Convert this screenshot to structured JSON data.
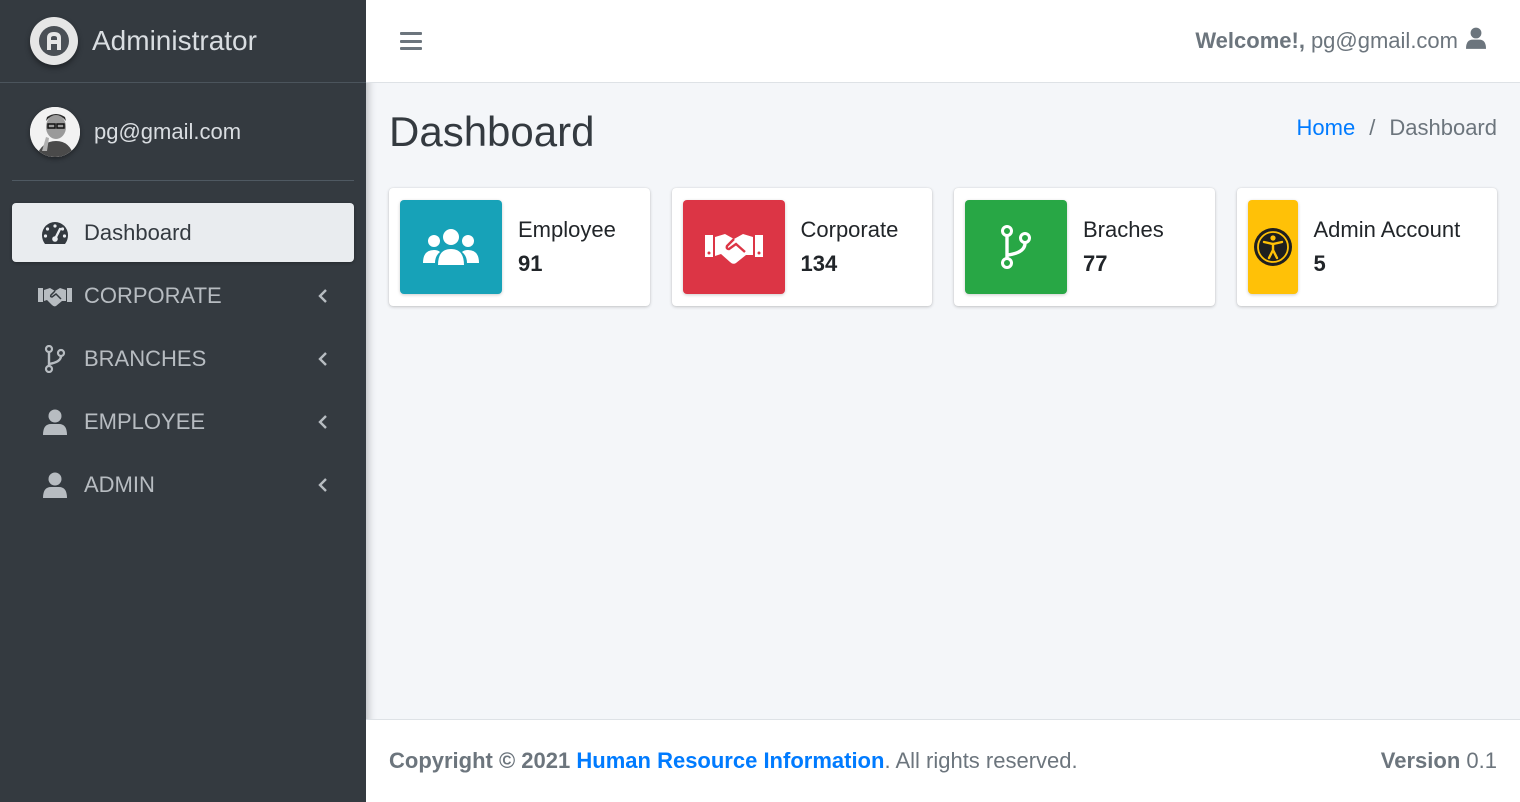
{
  "brand": {
    "title": "Administrator",
    "logo_letter": "A"
  },
  "user": {
    "name": "pg@gmail.com"
  },
  "sidebar": {
    "items": [
      {
        "label": "Dashboard",
        "icon": "tachometer-icon",
        "active": true
      },
      {
        "label": "CORPORATE",
        "icon": "handshake-icon"
      },
      {
        "label": "BRANCHES",
        "icon": "code-branch-icon"
      },
      {
        "label": "EMPLOYEE",
        "icon": "user-icon"
      },
      {
        "label": "ADMIN",
        "icon": "user-icon"
      }
    ]
  },
  "header": {
    "welcome_label": "Welcome!,",
    "user_email": "pg@gmail.com"
  },
  "page": {
    "title": "Dashboard"
  },
  "breadcrumb": {
    "home": "Home",
    "separator": "/",
    "current": "Dashboard"
  },
  "cards": [
    {
      "label": "Employee",
      "value": "91",
      "color": "#17a2b8",
      "icon": "users-icon"
    },
    {
      "label": "Corporate",
      "value": "134",
      "color": "#dc3545",
      "icon": "handshake-icon"
    },
    {
      "label": "Braches",
      "value": "77",
      "color": "#28a745",
      "icon": "code-branch-icon"
    },
    {
      "label": "Admin Account",
      "value": "5",
      "color": "#ffc107",
      "icon": "universal-access-icon"
    }
  ],
  "footer": {
    "copyright_prefix": "Copyright © 2021",
    "company": "Human Resource Information",
    "suffix": ". All rights reserved.",
    "version_label": "Version",
    "version_value": "0.1"
  }
}
